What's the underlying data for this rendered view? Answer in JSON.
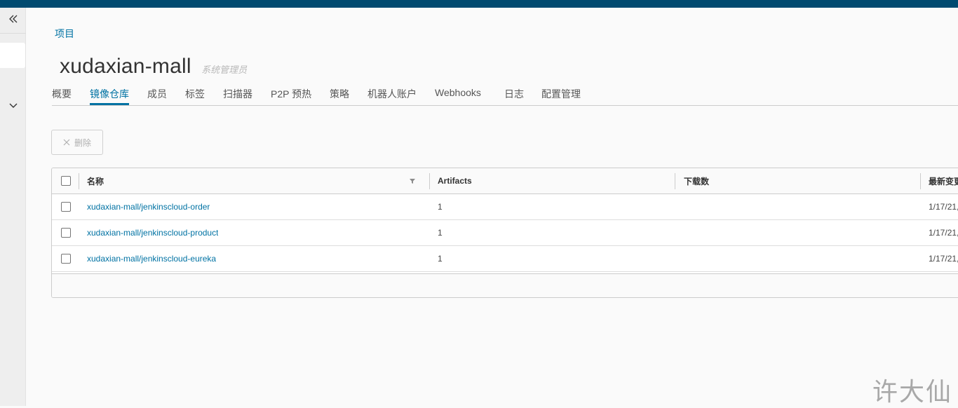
{
  "breadcrumb": {
    "label": "项目"
  },
  "header": {
    "title": "xudaxian-mall",
    "role": "系统管理员"
  },
  "tabs": [
    {
      "label": "概要",
      "active": false
    },
    {
      "label": "镜像仓库",
      "active": true
    },
    {
      "label": "成员",
      "active": false
    },
    {
      "label": "标签",
      "active": false
    },
    {
      "label": "扫描器",
      "active": false
    },
    {
      "label": "P2P 预热",
      "active": false
    },
    {
      "label": "策略",
      "active": false
    },
    {
      "label": "机器人账户",
      "active": false
    },
    {
      "label": "Webhooks",
      "active": false
    },
    {
      "label": "日志",
      "active": false
    },
    {
      "label": "配置管理",
      "active": false
    }
  ],
  "toolbar": {
    "delete_label": "删除",
    "delete_icon": "close-icon"
  },
  "table": {
    "columns": [
      "名称",
      "Artifacts",
      "下载数",
      "最新变更"
    ],
    "rows": [
      {
        "name": "xudaxian-mall/jenkinscloud-order",
        "artifacts": "1",
        "pulls": "",
        "updated": "1/17/21,"
      },
      {
        "name": "xudaxian-mall/jenkinscloud-product",
        "artifacts": "1",
        "pulls": "",
        "updated": "1/17/21,"
      },
      {
        "name": "xudaxian-mall/jenkinscloud-eureka",
        "artifacts": "1",
        "pulls": "",
        "updated": "1/17/21,"
      }
    ]
  },
  "sidebar": {
    "collapse_icon": "double-chevron-left-icon",
    "expand_icon": "chevron-down-icon"
  },
  "watermark": {
    "text": "许大仙"
  },
  "colors": {
    "accent": "#0072a3",
    "topbar": "#004a70"
  }
}
